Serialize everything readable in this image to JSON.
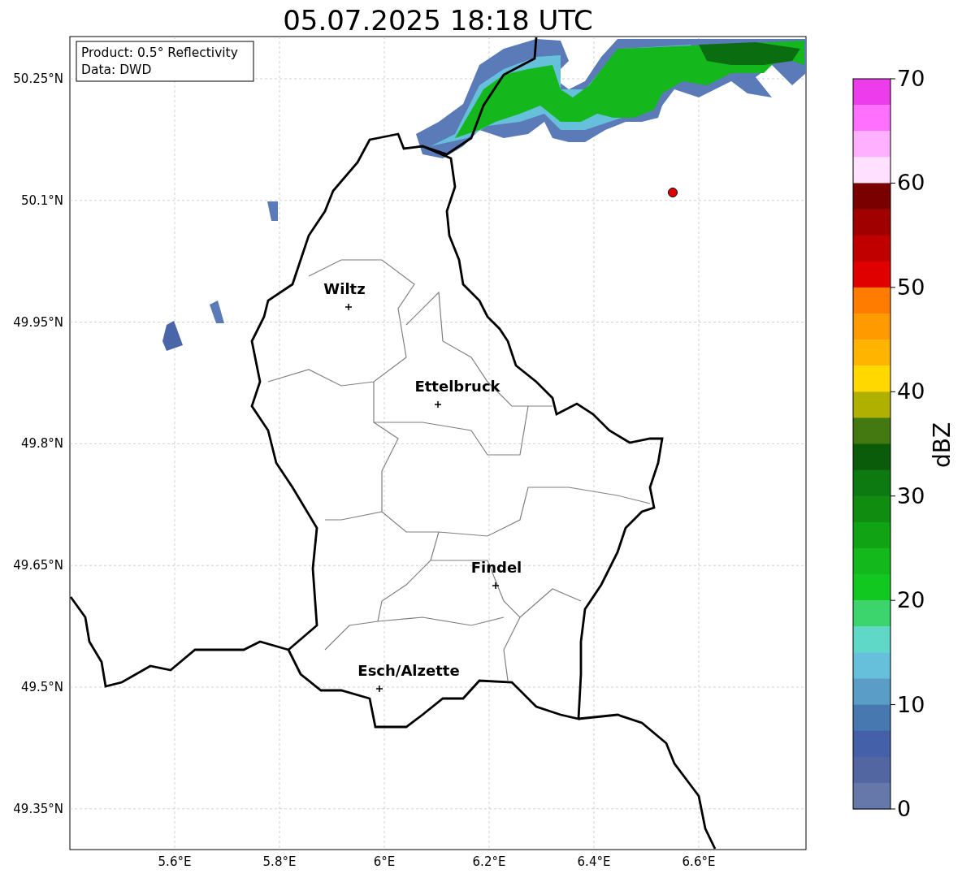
{
  "title": "05.07.2025 18:18 UTC",
  "info_box": [
    "Product: 0.5° Reflectivity",
    "Data: DWD"
  ],
  "lat_labels": [
    "50.25°N",
    "50.1°N",
    "49.95°N",
    "49.8°N",
    "49.65°N",
    "49.5°N",
    "49.35°N"
  ],
  "lon_labels": [
    "5.6°E",
    "5.8°E",
    "6°E",
    "6.2°E",
    "6.4°E",
    "6.6°E"
  ],
  "cities": [
    {
      "name": "Wiltz"
    },
    {
      "name": "Ettelbruck"
    },
    {
      "name": "Findel"
    },
    {
      "name": "Esch/Alzette"
    }
  ],
  "colorbar": {
    "label": "dBZ",
    "ticks": [
      "70",
      "60",
      "50",
      "40",
      "30",
      "20",
      "10",
      "0"
    ],
    "segments": [
      {
        "color": "#ec3cec"
      },
      {
        "color": "#ff70ff"
      },
      {
        "color": "#ffb0ff"
      },
      {
        "color": "#ffe0ff"
      },
      {
        "color": "#7a0000"
      },
      {
        "color": "#a00000"
      },
      {
        "color": "#c00000"
      },
      {
        "color": "#e00000"
      },
      {
        "color": "#ff7c00"
      },
      {
        "color": "#ff9a00"
      },
      {
        "color": "#ffb400"
      },
      {
        "color": "#ffd800"
      },
      {
        "color": "#b0b000"
      },
      {
        "color": "#447810"
      },
      {
        "color": "#0a5c0a"
      },
      {
        "color": "#0c7a10"
      },
      {
        "color": "#108c10"
      },
      {
        "color": "#10a414"
      },
      {
        "color": "#12b81c"
      },
      {
        "color": "#10c820"
      },
      {
        "color": "#3cd46c"
      },
      {
        "color": "#60d8c8"
      },
      {
        "color": "#66c0dc"
      },
      {
        "color": "#5a9ec8"
      },
      {
        "color": "#4878b0"
      },
      {
        "color": "#4460a8"
      },
      {
        "color": "#5266a2"
      },
      {
        "color": "#6677aa"
      }
    ]
  }
}
